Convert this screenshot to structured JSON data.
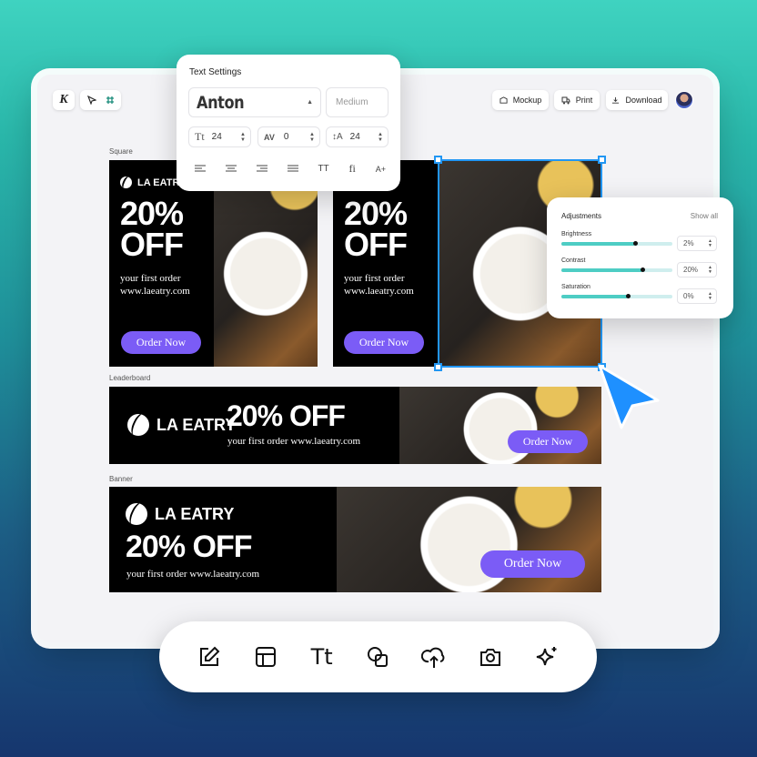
{
  "app": {
    "logo_letter": "K",
    "header_buttons": {
      "mockup": "Mockup",
      "print": "Print",
      "download": "Download"
    }
  },
  "sections": {
    "square": "Square",
    "leaderboard": "Leaderboard",
    "banner": "Banner"
  },
  "ad": {
    "brand": "LA EATRY",
    "offer": "20% OFF",
    "offer_line1": "20%",
    "offer_line2": "OFF",
    "sub_line1": "your first order",
    "sub_line2": "www.laeatry.com",
    "sub_full": "your first order www.laeatry.com",
    "cta": "Order Now",
    "cta_color": "#7b5cf6"
  },
  "text_settings": {
    "title": "Text Settings",
    "font": "Anton",
    "weight": "Medium",
    "size": "24",
    "tracking": "0",
    "line_height": "24",
    "tools": [
      "align-left",
      "align-center",
      "align-right",
      "align-justify",
      "uppercase",
      "ligature",
      "add-style"
    ],
    "uppercase_label": "TT",
    "ligature_label": "fi",
    "style_label": "A+"
  },
  "adjustments": {
    "title": "Adjustments",
    "show_all": "Show all",
    "items": [
      {
        "label": "Brightness",
        "value": "2%",
        "level": 0.66
      },
      {
        "label": "Contrast",
        "value": "20%",
        "level": 0.73
      },
      {
        "label": "Saturation",
        "value": "0%",
        "level": 0.6
      }
    ],
    "accent": "#4ecdc4"
  },
  "toolbar": [
    "edit-icon",
    "layout-icon",
    "text-icon",
    "shapes-icon",
    "upload-icon",
    "camera-icon",
    "sparkle-icon"
  ],
  "toolbar_text_glyph": "Tt"
}
